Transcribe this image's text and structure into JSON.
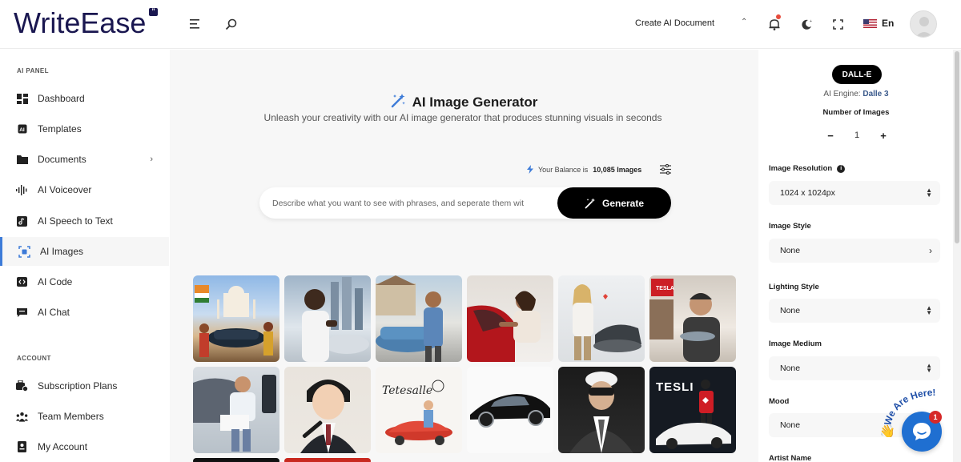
{
  "header": {
    "logo": "WriteEase",
    "logo_badge": "”",
    "create_document": "Create AI Document",
    "language": "En"
  },
  "sidebar": {
    "section_ai": "AI PANEL",
    "items": [
      {
        "label": "Dashboard",
        "icon": "dashboard-icon"
      },
      {
        "label": "Templates",
        "icon": "templates-icon"
      },
      {
        "label": "Documents",
        "icon": "folder-icon"
      },
      {
        "label": "AI Voiceover",
        "icon": "waveform-icon"
      },
      {
        "label": "AI Speech to Text",
        "icon": "speech-icon"
      },
      {
        "label": "AI Images",
        "icon": "image-icon"
      },
      {
        "label": "AI Code",
        "icon": "code-icon"
      },
      {
        "label": "AI Chat",
        "icon": "chat-icon"
      }
    ],
    "section_account": "ACCOUNT",
    "account_items": [
      {
        "label": "Subscription Plans",
        "icon": "subscription-icon"
      },
      {
        "label": "Team Members",
        "icon": "team-icon"
      },
      {
        "label": "My Account",
        "icon": "account-icon"
      }
    ]
  },
  "main": {
    "title": "AI Image Generator",
    "subtitle": "Unleash your creativity with our AI image generator that produces stunning visuals in seconds",
    "balance_prefix": "Your Balance is",
    "balance_value": "10,085 Images",
    "prompt_placeholder": "Describe what you want to see with phrases, and seperate them wit",
    "generate_label": "Generate",
    "gallery": [
      "taj-mahal-car",
      "man-city-car",
      "woman-car-driveway",
      "woman-red-car",
      "man-car-heart",
      "man-tesla-showroom",
      "man-car-charging",
      "anime-man-pen",
      "tetesalle-sketch",
      "black-sports-car",
      "man-vr-suit",
      "tesli-poster"
    ]
  },
  "panel": {
    "engine": "DALL-E",
    "engine_prefix": "AI Engine:",
    "engine_value": "Dalle 3",
    "num_images_label": "Number of Images",
    "num_images_value": "1",
    "minus": "−",
    "plus": "+",
    "resolution_label": "Image Resolution",
    "resolution_value": "1024 x 1024px",
    "style_label": "Image Style",
    "style_value": "None",
    "lighting_label": "Lighting Style",
    "lighting_value": "None",
    "medium_label": "Image Medium",
    "medium_value": "None",
    "mood_label": "Mood",
    "mood_value": "None",
    "artist_label": "Artist Name"
  },
  "chat": {
    "badge": "1",
    "tagline": "We Are Here!"
  },
  "colors": {
    "accent": "#3d7bd8",
    "brand": "#1a1750",
    "chat": "#1f6fd1"
  }
}
